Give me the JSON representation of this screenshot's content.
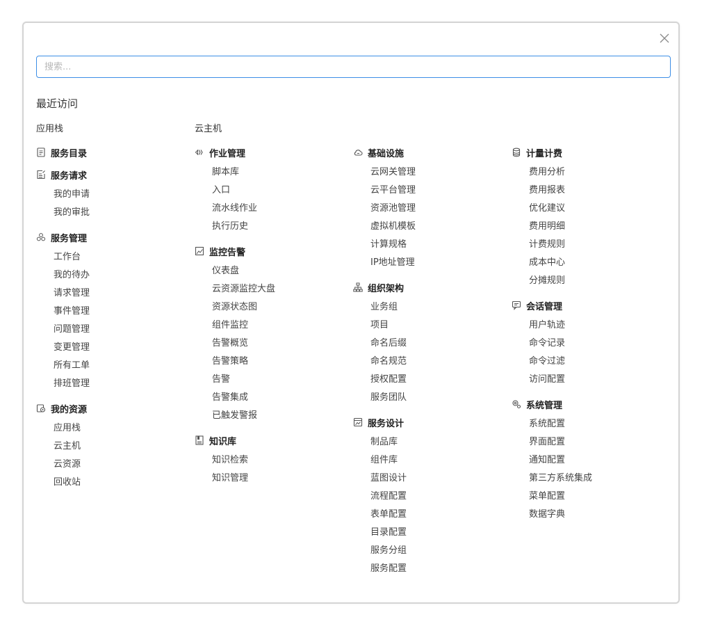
{
  "search": {
    "placeholder": "搜索..."
  },
  "recent": {
    "title": "最近访问",
    "items": [
      "应用栈",
      "云主机"
    ]
  },
  "columns": [
    [
      {
        "icon": "document-list-icon",
        "title": "服务目录",
        "items": []
      },
      {
        "icon": "edit-document-icon",
        "title": "服务请求",
        "items": [
          "我的申请",
          "我的审批"
        ]
      },
      {
        "icon": "cluster-icon",
        "title": "服务管理",
        "items": [
          "工作台",
          "我的待办",
          "请求管理",
          "事件管理",
          "问题管理",
          "变更管理",
          "所有工单",
          "排班管理"
        ]
      },
      {
        "icon": "resource-icon",
        "title": "我的资源",
        "items": [
          "应用栈",
          "云主机",
          "云资源",
          "回收站"
        ]
      }
    ],
    [
      {
        "icon": "job-icon",
        "title": "作业管理",
        "items": [
          "脚本库",
          "入口",
          "流水线作业",
          "执行历史"
        ]
      },
      {
        "icon": "chart-icon",
        "title": "监控告警",
        "items": [
          "仪表盘",
          "云资源监控大盘",
          "资源状态图",
          "组件监控",
          "告警概览",
          "告警策略",
          "告警",
          "告警集成",
          "已触发警报"
        ]
      },
      {
        "icon": "book-icon",
        "title": "知识库",
        "items": [
          "知识检索",
          "知识管理"
        ]
      }
    ],
    [
      {
        "icon": "cloud-icon",
        "title": "基础设施",
        "items": [
          "云网关管理",
          "云平台管理",
          "资源池管理",
          "虚拟机模板",
          "计算规格",
          "IP地址管理"
        ]
      },
      {
        "icon": "org-chart-icon",
        "title": "组织架构",
        "items": [
          "业务组",
          "项目",
          "命名后缀",
          "命名规范",
          "授权配置",
          "服务团队"
        ]
      },
      {
        "icon": "design-icon",
        "title": "服务设计",
        "items": [
          "制品库",
          "组件库",
          "蓝图设计",
          "流程配置",
          "表单配置",
          "目录配置",
          "服务分组",
          "服务配置"
        ]
      }
    ],
    [
      {
        "icon": "database-icon",
        "title": "计量计费",
        "items": [
          "费用分析",
          "费用报表",
          "优化建议",
          "费用明细",
          "计费规则",
          "成本中心",
          "分摊规则"
        ]
      },
      {
        "icon": "chat-icon",
        "title": "会话管理",
        "items": [
          "用户轨迹",
          "命令记录",
          "命令过滤",
          "访问配置"
        ]
      },
      {
        "icon": "gear-icon",
        "title": "系统管理",
        "items": [
          "系统配置",
          "界面配置",
          "通知配置",
          "第三方系统集成",
          "菜单配置",
          "数据字典"
        ]
      }
    ]
  ]
}
